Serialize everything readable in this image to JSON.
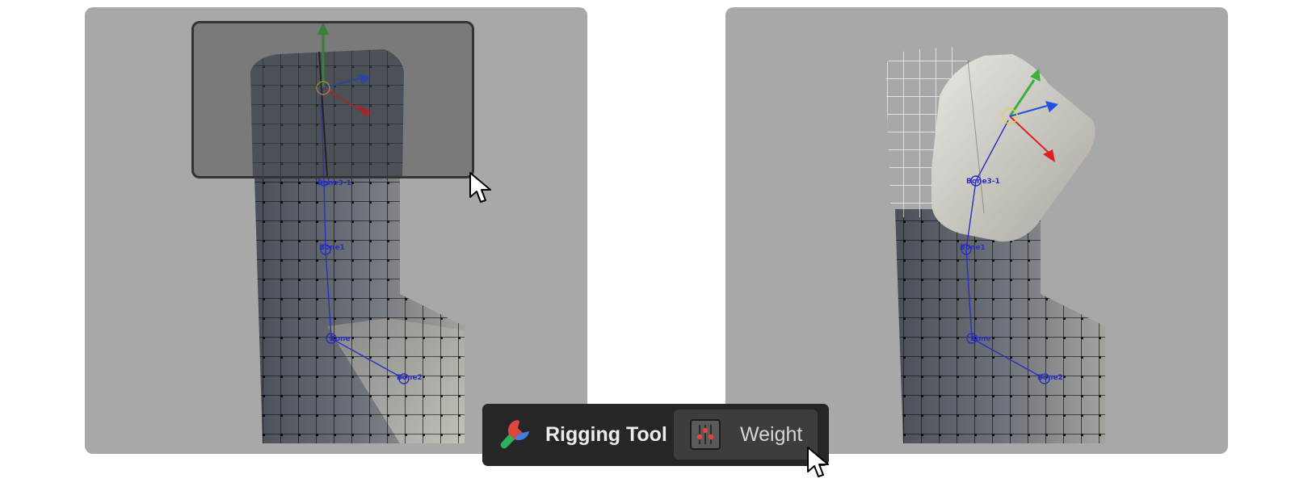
{
  "toolbar": {
    "tool_name": "Rigging Tool",
    "mode_button_label": "Weight",
    "tool_icon": "wrench-icon",
    "mode_icon": "sliders-icon"
  },
  "viewports": {
    "left": {
      "bone_labels": [
        "Bone3-1",
        "Bone1",
        "Bone",
        "Bone2"
      ]
    },
    "right": {
      "bone_labels": [
        "Bone3-1",
        "Bone1",
        "Bone",
        "Bone2"
      ]
    }
  },
  "colors": {
    "viewport_bg": "#a8a8a8",
    "toolbar_bg": "#262626",
    "bone_color": "#2a2fbf",
    "axis_x": "#e02020",
    "axis_y": "#3cb03c",
    "axis_z": "#2050e0"
  }
}
